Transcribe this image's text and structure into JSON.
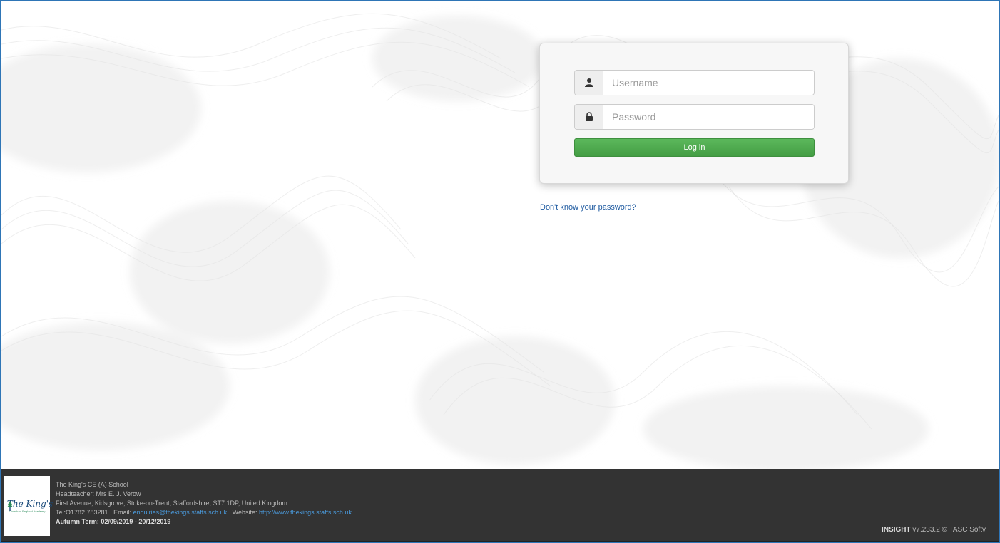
{
  "login": {
    "username_placeholder": "Username",
    "password_placeholder": "Password",
    "login_label": "Log in",
    "forgot_label": "Don't know your password?"
  },
  "footer": {
    "logo_text": "The King's",
    "logo_subtext": "Church of England Academy",
    "school_name": "The King's CE (A) School",
    "headteacher": "Headteacher: Mrs E. J. Verow",
    "address": "First Avenue, Kidsgrove, Stoke-on-Trent, Staffordshire, ST7 1DP, United Kingdom",
    "tel_label": "Tel:O1782 783281",
    "email_label": "Email:",
    "email": "enquiries@thekings.staffs.sch.uk",
    "website_label": "Website:",
    "website": "http://www.thekings.staffs.sch.uk",
    "term": "Autumn Term: 02/09/2019 - 20/12/2019",
    "app_name": "INSIGHT",
    "version": "v7.233.2 © TASC Softv"
  },
  "icons": {
    "username": "user-icon",
    "password": "lock-icon"
  },
  "colors": {
    "login_button": "#5cb85c",
    "link": "#1e5aa0",
    "footer_bg": "#333333",
    "footer_link": "#4a9adc",
    "frame_border": "#2e75b6"
  }
}
